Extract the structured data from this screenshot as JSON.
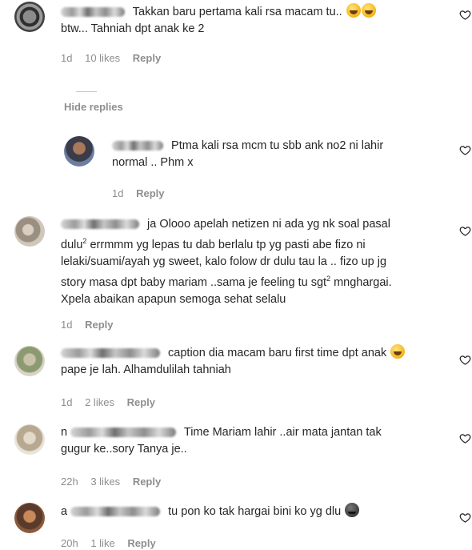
{
  "comments": [
    {
      "text": "Takkan baru pertama kali rsa macam tu..",
      "text_line2": "btw... Tahniah dpt anak ke 2",
      "time": "1d",
      "likes": "10 likes",
      "reply": "Reply"
    },
    {
      "is_reply": true,
      "text": "Ptma kali rsa mcm tu sbb ank no2 ni lahir",
      "text_line2": "normal .. Phm x",
      "time": "1d",
      "reply": "Reply"
    },
    {
      "text_l1": "ja Olooo apelah netizen ni ada yg nk soal pasal",
      "text_l2a": "dulu",
      "sup1": "2",
      "text_l2b": " errmmm yg lepas tu dab berlalu tp yg pasti abe fizo ni",
      "text_l3": "lelaki/suami/ayah yg sweet, kalo folow dr dulu tau la .. fizo up jg",
      "text_l4a": "story masa dpt baby mariam ..sama je feeling tu sgt",
      "sup2": "2",
      "text_l4b": " mnghargai.",
      "text_l5": "Xpela abaikan apapun semoga sehat selalu",
      "time": "1d",
      "reply": "Reply"
    },
    {
      "text": "caption dia macam baru first time dpt anak",
      "text_line2": "pape je lah. Alhamdulilah tahniah",
      "time": "1d",
      "likes": "2 likes",
      "reply": "Reply"
    },
    {
      "prefix": "n",
      "text": "Time Mariam lahir ..air mata jantan tak",
      "text_line2": "gugur ke..sory Tanya je..",
      "time": "22h",
      "likes": "3 likes",
      "reply": "Reply"
    },
    {
      "prefix": "a",
      "text": "tu pon ko tak hargai bini ko yg dlu",
      "time": "20h",
      "likes": "1 like",
      "reply": "Reply"
    }
  ],
  "hide_replies": "Hide replies",
  "colors": {
    "text": "#262626",
    "meta": "#8e8e8e",
    "background": "#ffffff"
  }
}
